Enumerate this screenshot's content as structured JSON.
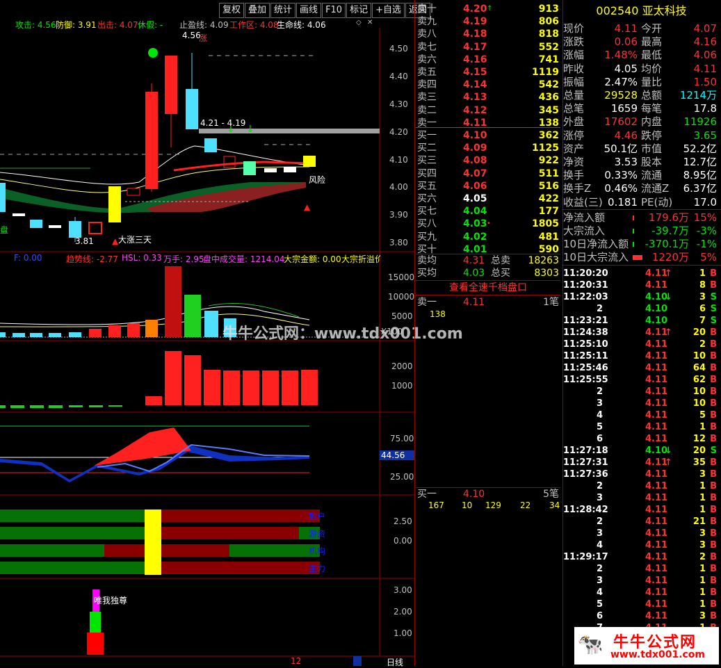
{
  "toolbar": {
    "buttons": [
      "复权",
      "叠加",
      "统计",
      "画线",
      "F10",
      "标记",
      "+自选",
      "返回"
    ]
  },
  "indicators": {
    "attack": "攻击: 4.56",
    "defend": "防御: 3.91",
    "out": "出击: 4.07",
    "rest": "休假: -",
    "stop": "止盈线: 4.09",
    "work": "工作区: 4.08",
    "life": "生命线: 4.06"
  },
  "kline": {
    "axis": [
      "4.50",
      "4.40",
      "4.30",
      "4.20",
      "4.10",
      "4.00",
      "3.90",
      "3.80"
    ],
    "hi_label": "4.56",
    "zhang": "涨",
    "range_label": "4.21 - 4.19",
    "lo_label": "3.81",
    "dazhang": "大涨三天",
    "fengxian": "风险",
    "pan": "盘"
  },
  "vol_bar": {
    "f": "F: 0.00",
    "trend": "趋势线: -2.77",
    "hsl": "HSL: 0.33",
    "wanshou": "万手: 2.95",
    "pan_vol": "盘中成交量: 1214.04",
    "dazong": "大宗金额: 0.00",
    "dazong2": "大宗折溢价",
    "axis": [
      "15000",
      "10000",
      "5000"
    ],
    "x100": "X100"
  },
  "panel3": {
    "axis": [
      "2000",
      "1000"
    ]
  },
  "panel4": {
    "axis": [
      "75.00",
      "25.00"
    ],
    "cur": "44.56"
  },
  "panel5": {
    "axis": [
      "2.50",
      "0.00"
    ],
    "labels": [
      "散户",
      "游资",
      "机构",
      "主力"
    ]
  },
  "panel6": {
    "axis": [
      "3.00",
      "2.00",
      "1.00"
    ],
    "label": "唯我独尊"
  },
  "bottom": {
    "num": "12",
    "period": "日线"
  },
  "watermark": "牛牛公式网：www.tdx001.com",
  "orderbook": {
    "sells": [
      {
        "label": "卖十",
        "price": "4.20",
        "vol": "913",
        "mark": "↑"
      },
      {
        "label": "卖九",
        "price": "4.19",
        "vol": "806"
      },
      {
        "label": "卖八",
        "price": "4.18",
        "vol": "818"
      },
      {
        "label": "卖七",
        "price": "4.17",
        "vol": "552"
      },
      {
        "label": "卖六",
        "price": "4.16",
        "vol": "741"
      },
      {
        "label": "卖五",
        "price": "4.15",
        "vol": "1119"
      },
      {
        "label": "卖四",
        "price": "4.14",
        "vol": "542"
      },
      {
        "label": "卖三",
        "price": "4.13",
        "vol": "436"
      },
      {
        "label": "卖二",
        "price": "4.12",
        "vol": "345"
      },
      {
        "label": "卖一",
        "price": "4.11",
        "vol": "138"
      }
    ],
    "buys": [
      {
        "label": "买一",
        "price": "4.10",
        "vol": "362"
      },
      {
        "label": "买二",
        "price": "4.09",
        "vol": "1125"
      },
      {
        "label": "买三",
        "price": "4.08",
        "vol": "922"
      },
      {
        "label": "买四",
        "price": "4.07",
        "vol": "511"
      },
      {
        "label": "买五",
        "price": "4.06",
        "vol": "516"
      },
      {
        "label": "买六",
        "price": "4.05",
        "vol": "422"
      },
      {
        "label": "买七",
        "price": "4.04",
        "vol": "177"
      },
      {
        "label": "买八",
        "price": "4.03",
        "vol": "1805",
        "mark": "•"
      },
      {
        "label": "买九",
        "price": "4.02",
        "vol": "481"
      },
      {
        "label": "买十",
        "price": "4.01",
        "vol": "590"
      }
    ],
    "avg_sell_label": "卖均",
    "avg_sell": "4.31",
    "total_sell_label": "总卖",
    "total_sell": "18263",
    "avg_buy_label": "买均",
    "avg_buy": "4.03",
    "total_buy_label": "总买",
    "total_buy": "8303",
    "view_all": "查看全速千档盘口",
    "sell1_label": "卖一",
    "sell1_price": "4.11",
    "sell1_count": "1笔",
    "sell1_vol": "138",
    "buy1_label": "买一",
    "buy1_price": "4.10",
    "buy1_count": "5笔",
    "buy1_vols": [
      "167",
      "10",
      "129",
      "22",
      "34"
    ]
  },
  "stock": {
    "code": "002540",
    "name": "亚太科技"
  },
  "quote": [
    {
      "l1": "现价",
      "v1": "4.11",
      "l2": "今开",
      "v2": "4.07",
      "c1": "red",
      "c2": "red"
    },
    {
      "l1": "涨跌",
      "v1": "0.06",
      "l2": "最高",
      "v2": "4.16",
      "c1": "red",
      "c2": "red"
    },
    {
      "l1": "涨幅",
      "v1": "1.48%",
      "l2": "最低",
      "v2": "4.06",
      "c1": "red",
      "c2": "red"
    },
    {
      "l1": "昨收",
      "v1": "4.05",
      "l2": "均价",
      "v2": "4.11",
      "c1": "white",
      "c2": "red"
    },
    {
      "l1": "振幅",
      "v1": "2.47%",
      "l2": "量比",
      "v2": "1.50",
      "c1": "white",
      "c2": "red"
    },
    {
      "l1": "总量",
      "v1": "29528",
      "l2": "总额",
      "v2": "1214万",
      "c1": "yellow",
      "c2": "cyan"
    },
    {
      "l1": "总笔",
      "v1": "1659",
      "l2": "每笔",
      "v2": "17.8",
      "c1": "white",
      "c2": "white"
    },
    {
      "l1": "外盘",
      "v1": "17602",
      "l2": "内盘",
      "v2": "11926",
      "c1": "red",
      "c2": "green"
    },
    {
      "l1": "涨停",
      "v1": "4.46",
      "l2": "跌停",
      "v2": "3.65",
      "c1": "red",
      "c2": "green"
    },
    {
      "l1": "资产",
      "v1": "50.1亿",
      "l2": "市值",
      "v2": "52.2亿",
      "c1": "white",
      "c2": "white"
    },
    {
      "l1": "净资",
      "v1": "3.53",
      "l2": "股本",
      "v2": "12.7亿",
      "c1": "white",
      "c2": "white"
    },
    {
      "l1": "换手",
      "v1": "0.33%",
      "l2": "流通",
      "v2": "8.95亿",
      "c1": "white",
      "c2": "white"
    },
    {
      "l1": "换手Z",
      "v1": "0.46%",
      "l2": "流通Z",
      "v2": "6.37亿",
      "c1": "white",
      "c2": "white"
    },
    {
      "l1": "收益(三)",
      "v1": "0.181",
      "l2": "PE(动)",
      "v2": "17.0",
      "c1": "white",
      "c2": "white"
    }
  ],
  "flows": [
    {
      "label": "净流入额",
      "val": "179.6万",
      "pct": "15%",
      "color": "red"
    },
    {
      "label": "大宗流入",
      "val": "-39.7万",
      "pct": "-3%",
      "color": "green"
    },
    {
      "label": "10日净流入额",
      "val": "-370.1万",
      "pct": "-1%",
      "color": "green"
    },
    {
      "label": "10日大宗流入",
      "val": "1220万",
      "pct": "5%",
      "color": "red"
    }
  ],
  "ticks": [
    {
      "t": "11:20:20",
      "p": "4.11",
      "a": "↑",
      "v": "1",
      "s": "B"
    },
    {
      "t": "11:20:31",
      "p": "4.11",
      "a": "",
      "v": "8",
      "s": "B"
    },
    {
      "t": "11:22:03",
      "p": "4.10",
      "a": "↓",
      "v": "3",
      "s": "S"
    },
    {
      "t": "2",
      "p": "4.10",
      "a": "",
      "v": "6",
      "s": "S"
    },
    {
      "t": "11:23:21",
      "p": "4.10",
      "a": "",
      "v": "7",
      "s": "S"
    },
    {
      "t": "11:24:38",
      "p": "4.11",
      "a": "↑",
      "v": "20",
      "s": "B"
    },
    {
      "t": "11:25:10",
      "p": "4.11",
      "a": "",
      "v": "2",
      "s": "B"
    },
    {
      "t": "11:25:11",
      "p": "4.11",
      "a": "",
      "v": "10",
      "s": "B"
    },
    {
      "t": "11:25:46",
      "p": "4.11",
      "a": "",
      "v": "64",
      "s": "B"
    },
    {
      "t": "11:25:55",
      "p": "4.11",
      "a": "",
      "v": "62",
      "s": "B"
    },
    {
      "t": "2",
      "p": "4.11",
      "a": "",
      "v": "10",
      "s": "B"
    },
    {
      "t": "3",
      "p": "4.11",
      "a": "",
      "v": "10",
      "s": "B"
    },
    {
      "t": "4",
      "p": "4.11",
      "a": "",
      "v": "5",
      "s": "B"
    },
    {
      "t": "5",
      "p": "4.11",
      "a": "",
      "v": "1",
      "s": "B"
    },
    {
      "t": "6",
      "p": "4.11",
      "a": "",
      "v": "12",
      "s": "B"
    },
    {
      "t": "11:27:18",
      "p": "4.10",
      "a": "↓",
      "v": "20",
      "s": "S"
    },
    {
      "t": "11:27:31",
      "p": "4.11",
      "a": "↑",
      "v": "35",
      "s": "B"
    },
    {
      "t": "11:27:36",
      "p": "4.11",
      "a": "",
      "v": "3",
      "s": "B"
    },
    {
      "t": "2",
      "p": "4.11",
      "a": "",
      "v": "1",
      "s": "B"
    },
    {
      "t": "3",
      "p": "4.11",
      "a": "",
      "v": "1",
      "s": "B"
    },
    {
      "t": "11:28:42",
      "p": "4.11",
      "a": "",
      "v": "1",
      "s": "B"
    },
    {
      "t": "2",
      "p": "4.11",
      "a": "",
      "v": "21",
      "s": "B"
    },
    {
      "t": "3",
      "p": "4.11",
      "a": "",
      "v": "3",
      "s": "B"
    },
    {
      "t": "4",
      "p": "4.11",
      "a": "",
      "v": "3",
      "s": "B"
    },
    {
      "t": "11:29:17",
      "p": "4.11",
      "a": "",
      "v": "2",
      "s": "B"
    },
    {
      "t": "2",
      "p": "4.11",
      "a": "",
      "v": "1",
      "s": "B"
    },
    {
      "t": "3",
      "p": "4.11",
      "a": "",
      "v": "1",
      "s": "B"
    },
    {
      "t": "4",
      "p": "4.11",
      "a": "",
      "v": "1",
      "s": "B"
    },
    {
      "t": "5",
      "p": "4.11",
      "a": "",
      "v": "1",
      "s": "B"
    },
    {
      "t": "6",
      "p": "4.11",
      "a": "",
      "v": "3",
      "s": "B"
    },
    {
      "t": "7",
      "p": "4.11",
      "a": "",
      "v": "1",
      "s": "B"
    }
  ],
  "logo": {
    "title": "牛牛公式网",
    "url": "www.tdx001.com"
  }
}
